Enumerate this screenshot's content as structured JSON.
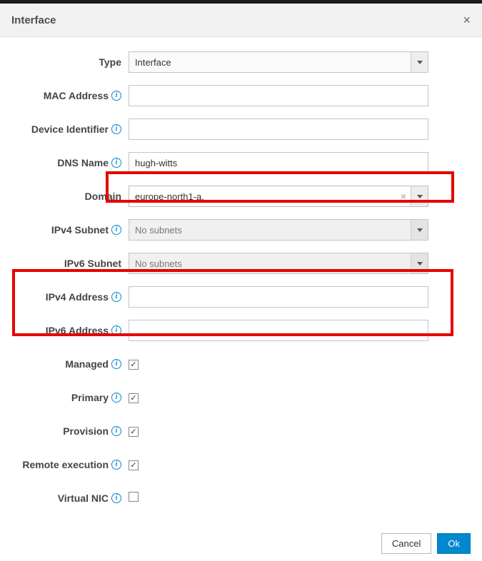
{
  "header": {
    "title": "Interface",
    "close": "×"
  },
  "labels": {
    "type": "Type",
    "mac": "MAC Address",
    "device_id": "Device Identifier",
    "dns": "DNS Name",
    "domain": "Domain",
    "ipv4_subnet": "IPv4 Subnet",
    "ipv6_subnet": "IPv6 Subnet",
    "ipv4_addr": "IPv4 Address",
    "ipv6_addr": "IPv6 Address",
    "managed": "Managed",
    "primary": "Primary",
    "provision": "Provision",
    "remote_exec": "Remote execution",
    "virtual_nic": "Virtual NIC"
  },
  "values": {
    "type": "Interface",
    "mac": "",
    "device_id": "",
    "dns": "hugh-witts",
    "domain": "europe-north1-a.",
    "ipv4_subnet": "No subnets",
    "ipv6_subnet": "No subnets",
    "ipv4_addr": "",
    "ipv6_addr": "",
    "managed": true,
    "primary": true,
    "provision": true,
    "remote_exec": true,
    "virtual_nic": false
  },
  "footer": {
    "cancel": "Cancel",
    "ok": "Ok"
  },
  "icons": {
    "info": "i",
    "check": "✓",
    "clear": "×"
  }
}
